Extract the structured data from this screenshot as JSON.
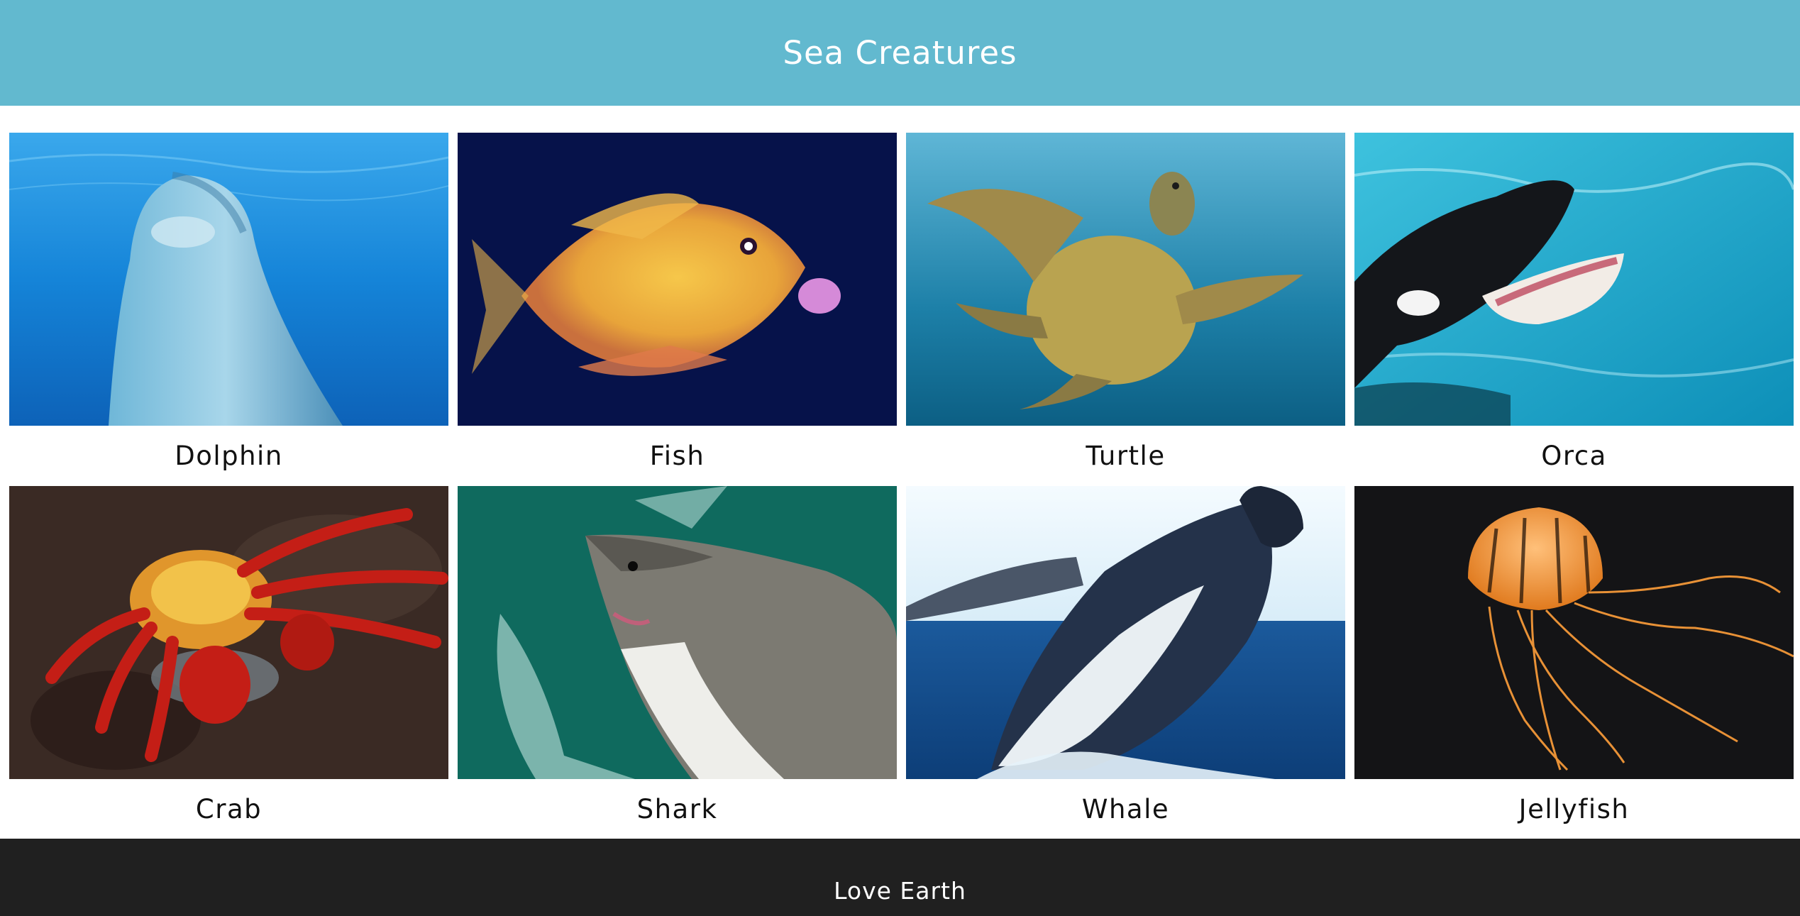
{
  "header": {
    "title": "Sea Creatures",
    "background": "#62b9cf"
  },
  "gallery": {
    "items": [
      {
        "label": "Dolphin",
        "image": "dolphin-underwater-photo"
      },
      {
        "label": "Fish",
        "image": "yellow-fish-photo"
      },
      {
        "label": "Turtle",
        "image": "sea-turtle-photo"
      },
      {
        "label": "Orca",
        "image": "orca-pool-photo"
      },
      {
        "label": "Crab",
        "image": "red-crab-on-rock-photo"
      },
      {
        "label": "Shark",
        "image": "great-white-shark-photo"
      },
      {
        "label": "Whale",
        "image": "breaching-humpback-whale-photo"
      },
      {
        "label": "Jellyfish",
        "image": "orange-jellyfish-photo"
      }
    ]
  },
  "footer": {
    "text": "Love Earth",
    "background": "#202020"
  }
}
